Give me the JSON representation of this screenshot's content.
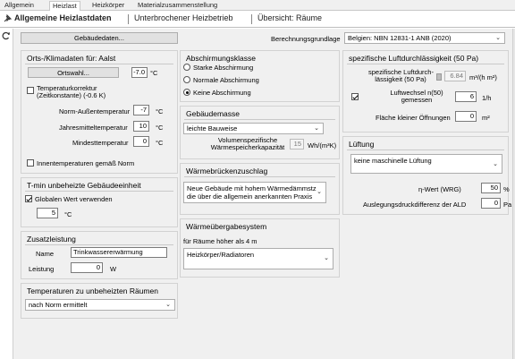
{
  "tabs": [
    "Allgemein",
    "Heizlast",
    "Heizkörper",
    "Materialzusammenstellung"
  ],
  "subtabs": [
    "Allgemeine Heizlastdaten",
    "Unterbrochener Heizbetrieb",
    "Übersicht: Räume"
  ],
  "main": {
    "gebaeudedaten_button": "Gebäudedaten...",
    "berechnungsgrundlage": {
      "label": "Berechnungsgrundlage",
      "value": "Belgien: NBN 12831-1 ANB (2020)"
    }
  },
  "klima": {
    "title": "Orts-/Klimadaten für: Aalst",
    "ortswahl_button": "Ortswahl...",
    "temp_value": "-7.0",
    "temp_unit": "°C",
    "korrektur_label_1": "Temperaturkorrektur",
    "korrektur_label_2": "(Zeitkonstante) (-0.6 K)",
    "norm_label": "Norm-Außentemperatur",
    "norm_value": "-7",
    "norm_unit": "°C",
    "jahres_label": "Jahresmitteltemperatur",
    "jahres_value": "10",
    "jahres_unit": "°C",
    "mindest_label": "Mindesttemperatur",
    "mindest_value": "0",
    "mindest_unit": "°C",
    "innen_label": "Innentemperaturen gemäß Norm"
  },
  "tmin": {
    "title": "T-min unbeheizte Gebäudeeinheit",
    "global_label": "Globalen Wert verwenden",
    "value": "5",
    "unit": "°C"
  },
  "zusatz": {
    "title": "Zusatzleistung",
    "name_label": "Name",
    "name_value": "Trinkwassererwärmung",
    "leistung_label": "Leistung",
    "leistung_value": "0",
    "leistung_unit": "W"
  },
  "unbeheizt": {
    "title": "Temperaturen zu unbeheizten Räumen",
    "value": "nach Norm ermittelt"
  },
  "abschirmung": {
    "title": "Abschirmungsklasse",
    "options": [
      "Starke Abschirmung",
      "Normale Abschirmung",
      "Keine Abschirmung"
    ]
  },
  "gebaeudemasse": {
    "title": "Gebäudemasse",
    "value": "leichte Bauweise",
    "kap_label_1": "Volumenspezifische",
    "kap_label_2": "Wärmespeicherkapazität",
    "kap_value": "15",
    "kap_unit": "Wh/(m³K)"
  },
  "waermebruecken": {
    "title": "Wärmebrückenzuschlag",
    "value_1": "Neue Gebäude mit hohem Wärmedämmstz",
    "value_2": "die über die allgemein anerkannten Praxis"
  },
  "uebergabe": {
    "title": "Wärmeübergabesystem",
    "subtitle": "für Räume höher als 4 m",
    "value": "Heizkörper/Radiatoren"
  },
  "luftdicht": {
    "title": "spezifische Luftdurchlässigkeit (50 Pa)",
    "spez_label_1": "spezifische Luftdurch-",
    "spez_label_2": "lässigkeit (50 Pa)",
    "spez_value": "6.84",
    "spez_unit": "m³/(h m²)",
    "luftwechsel_label_1": "Luftwechsel n(50)",
    "luftwechsel_label_2": "gemessen",
    "luftwechsel_value": "6",
    "luftwechsel_unit": "1/h",
    "flaeche_label": "Fläche kleiner Öffnungen",
    "flaeche_value": "0",
    "flaeche_unit": "m²"
  },
  "lueftung": {
    "title": "Lüftung",
    "value": "keine maschinelle Lüftung",
    "eta_label": "η-Wert (WRG)",
    "eta_value": "50",
    "eta_unit": "%",
    "ald_label": "Auslegungsdruckdifferenz der ALD",
    "ald_value": "0",
    "ald_unit": "Pa"
  }
}
